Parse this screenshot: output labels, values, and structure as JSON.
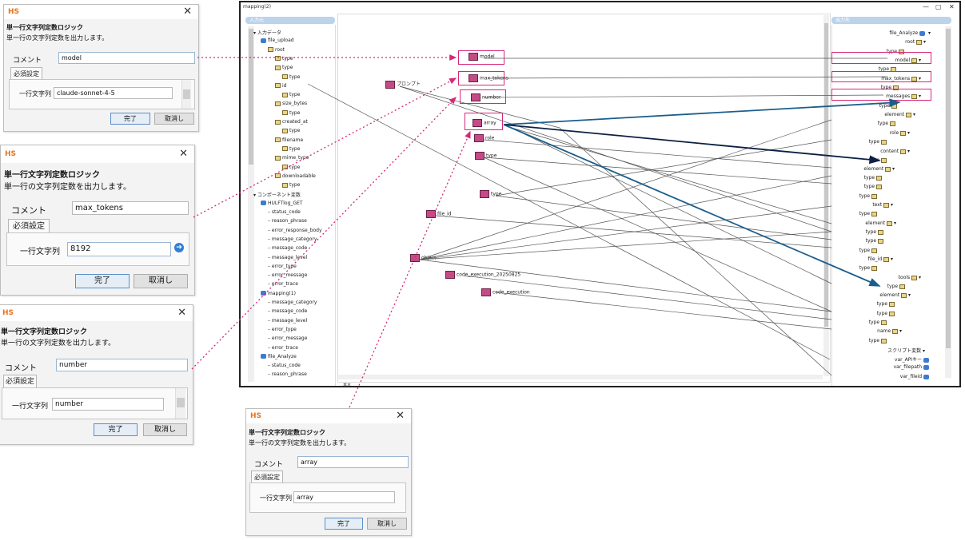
{
  "dialogs": {
    "d1": {
      "logo": "HS",
      "close": "✕",
      "title": "単一行文字列定数ロジック",
      "desc": "単一行の文字列定数を出力します。",
      "comment_label": "コメント",
      "comment_value": "model",
      "tab": "必須設定",
      "field_label": "一行文字列",
      "field_value": "claude-sonnet-4-5",
      "ok": "完了",
      "cancel": "取消し"
    },
    "d2": {
      "logo": "HS",
      "close": "✕",
      "title": "単一行文字列定数ロジック",
      "desc": "単一行の文字列定数を出力します。",
      "comment_label": "コメント",
      "comment_value": "max_tokens",
      "tab": "必須設定",
      "field_label": "一行文字列",
      "field_value": "8192",
      "ok": "完了",
      "cancel": "取消し"
    },
    "d3": {
      "logo": "HS",
      "close": "✕",
      "title": "単一行文字列定数ロジック",
      "desc": "単一行の文字列定数を出力します。",
      "comment_label": "コメント",
      "comment_value": "number",
      "tab": "必須設定",
      "field_label": "一行文字列",
      "field_value": "number",
      "ok": "完了",
      "cancel": "取消し"
    },
    "d4": {
      "logo": "HS",
      "close": "✕",
      "title": "単一行文字列定数ロジック",
      "desc": "単一行の文字列定数を出力します。",
      "comment_label": "コメント",
      "comment_value": "array",
      "tab": "必須設定",
      "field_label": "一行文字列",
      "field_value": "array",
      "ok": "完了",
      "cancel": "取消し"
    }
  },
  "window": {
    "title": "mapping(2)",
    "min": "—",
    "max": "▢",
    "close": "✕",
    "input_pane": "入力元",
    "output_pane": "出力先",
    "bottom_label": "基本"
  },
  "input_tree": [
    {
      "label": "入力データ"
    },
    {
      "label": "file_upload"
    },
    {
      "label": "root"
    },
    {
      "label": "type"
    },
    {
      "label": "type"
    },
    {
      "label": "type"
    },
    {
      "label": "id"
    },
    {
      "label": "type"
    },
    {
      "label": "size_bytes"
    },
    {
      "label": "type"
    },
    {
      "label": "created_at"
    },
    {
      "label": "type"
    },
    {
      "label": "filename"
    },
    {
      "label": "type"
    },
    {
      "label": "mime_type"
    },
    {
      "label": "type"
    },
    {
      "label": "downloadable"
    },
    {
      "label": "type"
    },
    {
      "label": "コンポーネント変数"
    },
    {
      "label": "HULFTlog_GET"
    },
    {
      "label": "status_code"
    },
    {
      "label": "reason_phrase"
    },
    {
      "label": "error_response_body"
    },
    {
      "label": "message_category"
    },
    {
      "label": "message_code"
    },
    {
      "label": "message_level"
    },
    {
      "label": "error_type"
    },
    {
      "label": "error_message"
    },
    {
      "label": "error_trace"
    },
    {
      "label": "mapping(1)"
    },
    {
      "label": "message_category"
    },
    {
      "label": "message_code"
    },
    {
      "label": "message_level"
    },
    {
      "label": "error_type"
    },
    {
      "label": "error_message"
    },
    {
      "label": "error_trace"
    },
    {
      "label": "file_Analyze"
    },
    {
      "label": "status_code"
    },
    {
      "label": "reason_phrase"
    }
  ],
  "canvas_nodes": [
    {
      "label": "model"
    },
    {
      "label": "max_tokens"
    },
    {
      "label": "number"
    },
    {
      "label": "array"
    },
    {
      "label": "role"
    },
    {
      "label": "type"
    },
    {
      "label": "プロンプト"
    },
    {
      "label": "type"
    },
    {
      "label": "file_id"
    },
    {
      "label": "object"
    },
    {
      "label": "code_execution_20250825"
    },
    {
      "label": "code_execution"
    }
  ],
  "output_tree": [
    {
      "label": "file_Analyze"
    },
    {
      "label": "root"
    },
    {
      "label": "type"
    },
    {
      "label": "model"
    },
    {
      "label": "type"
    },
    {
      "label": "max_tokens"
    },
    {
      "label": "type"
    },
    {
      "label": "messages"
    },
    {
      "label": "type"
    },
    {
      "label": "element"
    },
    {
      "label": "type"
    },
    {
      "label": "role"
    },
    {
      "label": "type"
    },
    {
      "label": "content"
    },
    {
      "label": "type"
    },
    {
      "label": "element"
    },
    {
      "label": "type"
    },
    {
      "label": "type"
    },
    {
      "label": "type"
    },
    {
      "label": "text"
    },
    {
      "label": "type"
    },
    {
      "label": "element"
    },
    {
      "label": "type"
    },
    {
      "label": "type"
    },
    {
      "label": "type"
    },
    {
      "label": "file_id"
    },
    {
      "label": "type"
    },
    {
      "label": "tools"
    },
    {
      "label": "type"
    },
    {
      "label": "element"
    },
    {
      "label": "type"
    },
    {
      "label": "type"
    },
    {
      "label": "type"
    },
    {
      "label": "name"
    },
    {
      "label": "type"
    },
    {
      "label": "スクリプト変数"
    },
    {
      "label": "var_APIキー"
    },
    {
      "label": "var_filepath"
    },
    {
      "label": "var_fileid"
    }
  ],
  "colors": {
    "highlight": "#d6287a",
    "connector_dark": "#1b5e8c",
    "connector_navy": "#0d1f44",
    "icon_logic": "#c44b86"
  }
}
